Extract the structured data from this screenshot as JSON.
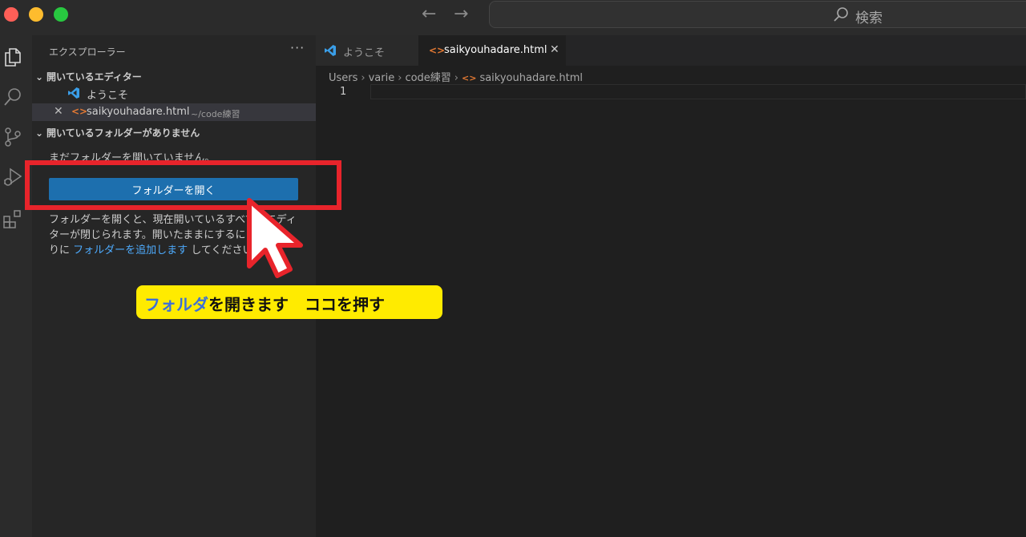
{
  "window": {
    "search_label": "検索",
    "traffic_colors": [
      "#ff5f57",
      "#febc2e",
      "#28c840"
    ]
  },
  "activity_bar": {
    "icons": [
      "explorer-icon",
      "search-icon",
      "source-control-icon",
      "run-debug-icon",
      "extensions-icon"
    ]
  },
  "sidebar": {
    "title": "エクスプローラー",
    "more_label": "···",
    "open_editors": {
      "header": "開いているエディター",
      "items": [
        {
          "label": "ようこそ",
          "icon": "vscode-icon"
        },
        {
          "label": "saikyouhadare.html",
          "description": "~/code練習",
          "icon": "html-icon",
          "close_label": "✕"
        }
      ]
    },
    "no_folder": {
      "header": "開いているフォルダーがありません",
      "message": "まだフォルダーを開いていません。",
      "button_label": "フォルダーを開く",
      "help_text_before": "フォルダーを開くと、現在開いているすべてのエディターが閉じられます。開いたままにするには、代わりに",
      "help_link": "フォルダーを追加します",
      "help_text_after": "してください。"
    }
  },
  "editor": {
    "tabs": [
      {
        "label": "ようこそ",
        "icon": "vscode-icon",
        "active": false
      },
      {
        "label": "saikyouhadare.html",
        "icon": "html-icon",
        "active": true,
        "close_label": "✕"
      }
    ],
    "breadcrumb": [
      "Users",
      "varie",
      "code練習",
      "saikyouhadare.html"
    ],
    "line_numbers": [
      "1"
    ]
  },
  "annotation": {
    "callout_accent": "フォルダ",
    "callout_rest": "を開きます　ココを押す",
    "highlight_color": "#e8242b",
    "callout_color": "#ffeb00"
  },
  "colors": {
    "button_blue": "#1d6fae",
    "link_blue": "#4daafc",
    "html_orange": "#e37933"
  }
}
